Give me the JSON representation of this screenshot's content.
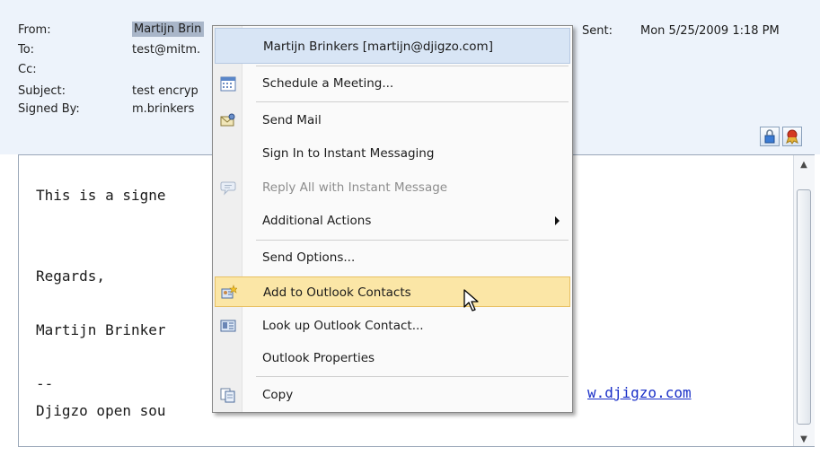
{
  "header": {
    "from_label": "From:",
    "from_value": "Martijn Brin",
    "to_label": "To:",
    "to_value": "test@mitm.",
    "cc_label": "Cc:",
    "cc_value": "",
    "subject_label": "Subject:",
    "subject_value": "test encryp",
    "signed_by_label": "Signed By:",
    "signed_by_value": "m.brinkers",
    "sent_label": "Sent:",
    "sent_value": "Mon 5/25/2009 1:18 PM",
    "encryption_icon": "padlock-icon",
    "signature_icon": "certificate-ribbon-icon"
  },
  "body": {
    "lines": [
      "This is a signe",
      "",
      "",
      "Regards,",
      "",
      "Martijn Brinker",
      "",
      "--",
      "Djigzo open sou"
    ],
    "link_fragment": "w.djigzo.com"
  },
  "context_menu": {
    "items": [
      {
        "label": "Martijn Brinkers [martijn@djigzo.com]",
        "icon": "",
        "state": "highlight"
      },
      {
        "label": "Schedule a Meeting...",
        "icon": "calendar-icon",
        "state": "normal"
      },
      {
        "label": "Send Mail",
        "icon": "mail-envelope-icon",
        "state": "normal"
      },
      {
        "label": "Sign In to Instant Messaging",
        "icon": "",
        "state": "normal"
      },
      {
        "label": "Reply All with Instant Message",
        "icon": "speech-bubble-icon",
        "state": "disabled"
      },
      {
        "label": "Additional Actions",
        "icon": "",
        "state": "submenu"
      },
      {
        "label": "Send Options...",
        "icon": "",
        "state": "normal"
      },
      {
        "label": "Add to Outlook Contacts",
        "icon": "add-contact-icon",
        "state": "hover"
      },
      {
        "label": "Look up Outlook Contact...",
        "icon": "contact-card-icon",
        "state": "normal"
      },
      {
        "label": "Outlook Properties",
        "icon": "",
        "state": "normal"
      },
      {
        "label": "Copy",
        "icon": "copy-icon",
        "state": "normal"
      }
    ]
  },
  "colors": {
    "header_bg": "#edf3fb",
    "menu_hover": "#fbe6a6",
    "menu_highlight": "#d8e5f5",
    "link": "#1a30c8"
  }
}
